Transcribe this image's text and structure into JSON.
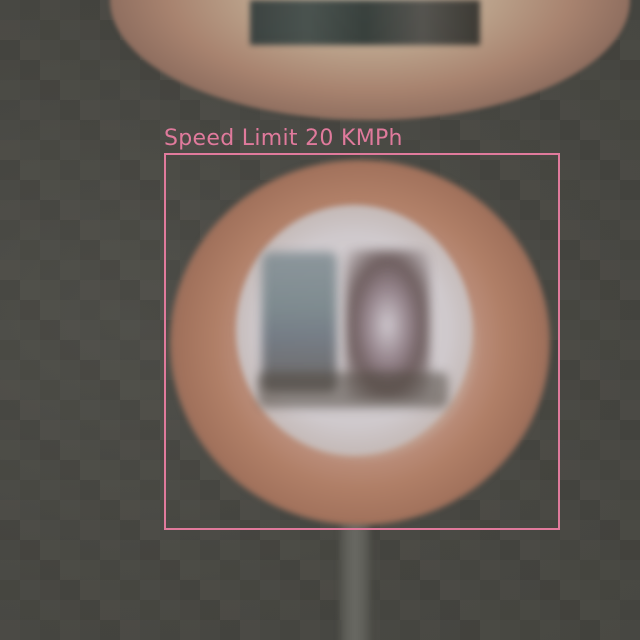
{
  "detection": {
    "label": "Speed Limit 20 KMPh",
    "box_color": "#e07a9c"
  }
}
